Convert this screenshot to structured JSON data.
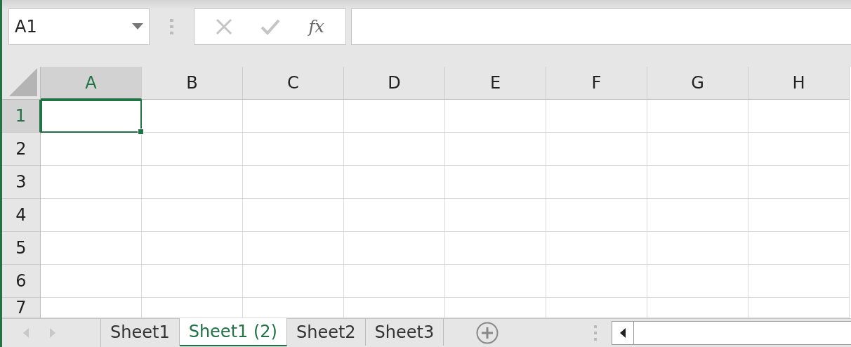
{
  "name_box": {
    "value": "A1"
  },
  "formula_bar": {
    "function_label": "fx"
  },
  "columns": [
    {
      "label": "A",
      "selected": true
    },
    {
      "label": "B",
      "selected": false
    },
    {
      "label": "C",
      "selected": false
    },
    {
      "label": "D",
      "selected": false
    },
    {
      "label": "E",
      "selected": false
    },
    {
      "label": "F",
      "selected": false
    },
    {
      "label": "G",
      "selected": false
    },
    {
      "label": "H",
      "selected": false
    }
  ],
  "rows": [
    {
      "label": "1",
      "selected": true
    },
    {
      "label": "2",
      "selected": false
    },
    {
      "label": "3",
      "selected": false
    },
    {
      "label": "4",
      "selected": false
    },
    {
      "label": "5",
      "selected": false
    },
    {
      "label": "6",
      "selected": false
    },
    {
      "label": "7",
      "selected": false
    }
  ],
  "sheet_nav": {
    "disabled": true
  },
  "sheet_tabs": [
    {
      "label": "Sheet1",
      "selected": false
    },
    {
      "label": "Sheet1 (2)",
      "selected": true
    },
    {
      "label": "Sheet2",
      "selected": false
    },
    {
      "label": "Sheet3",
      "selected": false
    }
  ]
}
